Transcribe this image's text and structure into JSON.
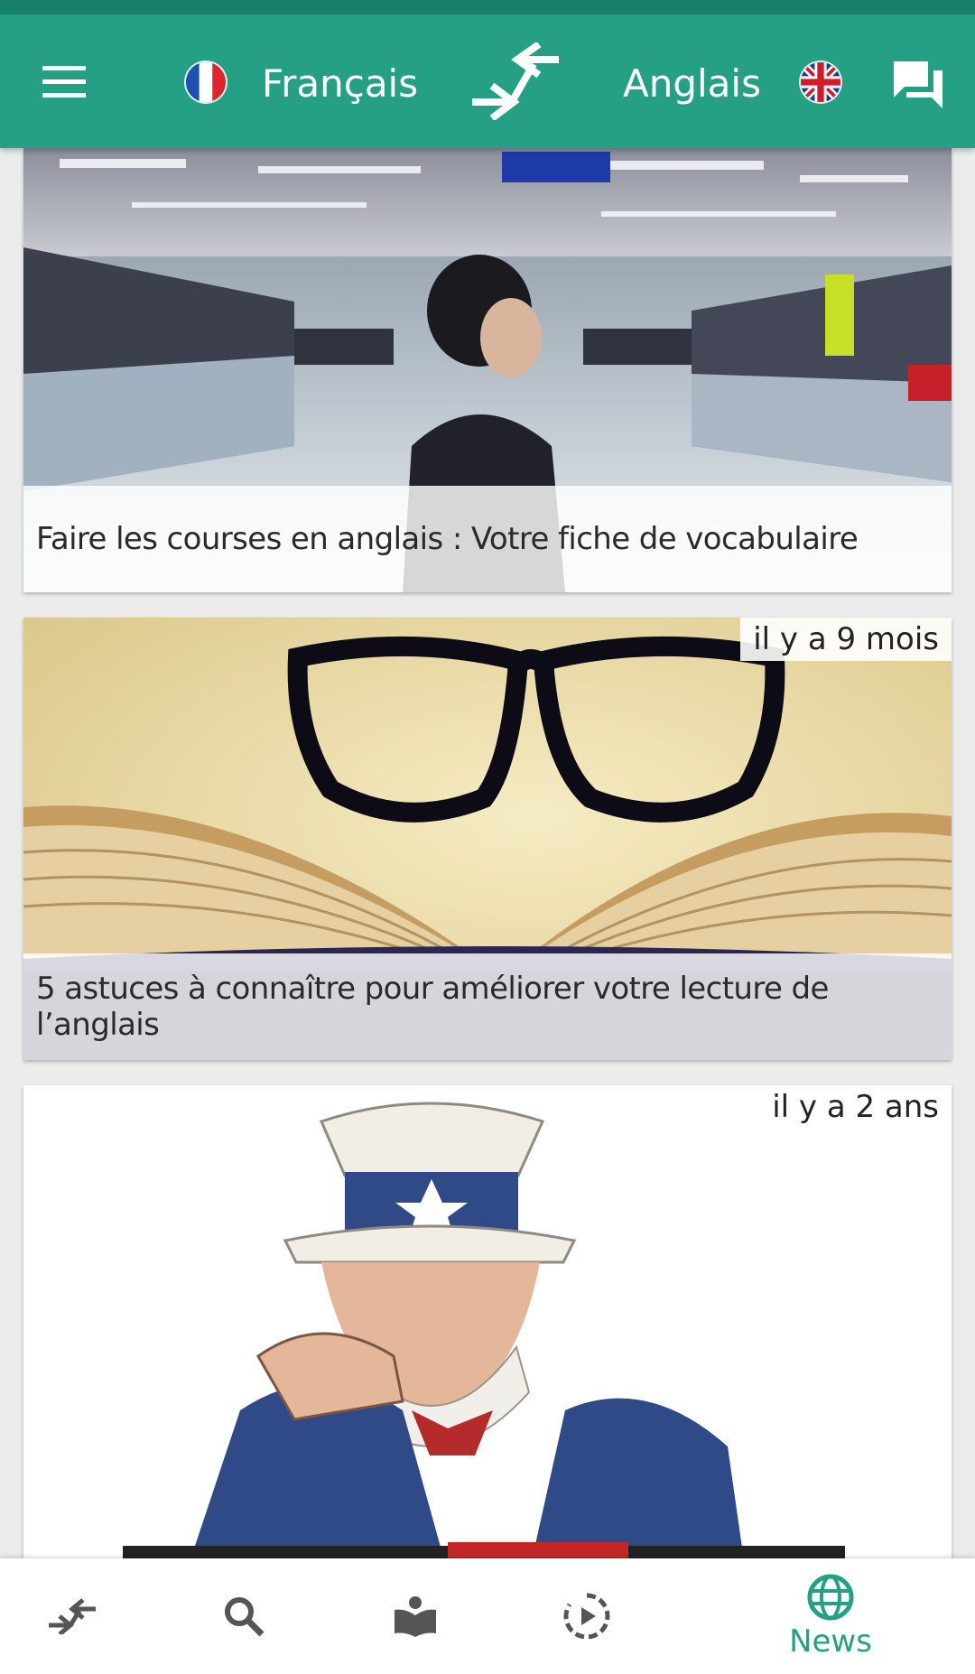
{
  "header": {
    "source_language": "Français",
    "target_language": "Anglais",
    "icons": [
      "menu-icon",
      "france-flag-icon",
      "swap-languages-icon",
      "uk-flag-icon",
      "chat-icon"
    ]
  },
  "articles": [
    {
      "title": "Faire les courses en anglais : Votre fiche de vocabulaire",
      "image": "shopping-mall-photo"
    },
    {
      "title": "5 astuces à connaître pour améliorer votre lecture de l’anglais",
      "age": "il y a 9 mois",
      "image": "glasses-on-book-photo"
    },
    {
      "age": "il y a 2 ans",
      "image": "uncle-sam-poster"
    }
  ],
  "bottom_nav": {
    "items": [
      "translate-icon",
      "search-icon",
      "reader-icon",
      "play-icon",
      "globe-icon"
    ],
    "active_label": "News"
  },
  "colors": {
    "primary": "#26a085",
    "primary_dark": "#19816a"
  }
}
